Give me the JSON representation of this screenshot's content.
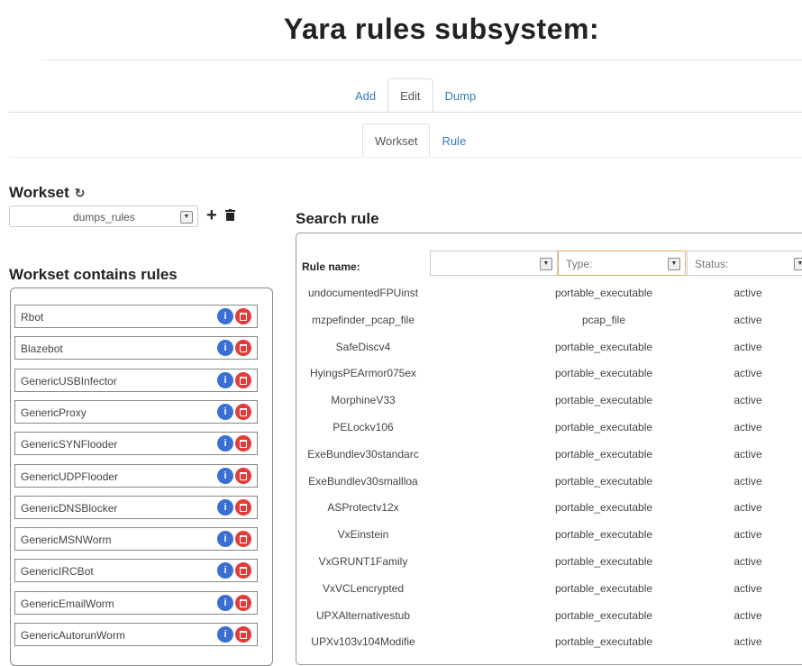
{
  "title": "Yara rules subsystem:",
  "main_tabs": [
    "Add",
    "Edit",
    "Dump"
  ],
  "sub_tabs": [
    "Workset",
    "Rule"
  ],
  "workset": {
    "heading": "Workset",
    "selected": "dumps_rules"
  },
  "contains": {
    "heading": "Workset contains rules",
    "rules": [
      "Rbot",
      "Blazebot",
      "GenericUSBInfector",
      "GenericProxy",
      "GenericSYNFlooder",
      "GenericUDPFlooder",
      "GenericDNSBlocker",
      "GenericMSNWorm",
      "GenericIRCBot",
      "GenericEmailWorm",
      "GenericAutorunWorm"
    ]
  },
  "search": {
    "heading": "Search rule",
    "rule_name_label": "Rule name:",
    "type_placeholder": "Type:",
    "status_placeholder": "Status:",
    "results": [
      {
        "name": "undocumentedFPUinst",
        "type": "portable_executable",
        "status": "active"
      },
      {
        "name": "mzpefinder_pcap_file",
        "type": "pcap_file",
        "status": "active"
      },
      {
        "name": "SafeDiscv4",
        "type": "portable_executable",
        "status": "active"
      },
      {
        "name": "HyingsPEArmor075ex",
        "type": "portable_executable",
        "status": "active"
      },
      {
        "name": "MorphineV33",
        "type": "portable_executable",
        "status": "active"
      },
      {
        "name": "PELockv106",
        "type": "portable_executable",
        "status": "active"
      },
      {
        "name": "ExeBundlev30standarc",
        "type": "portable_executable",
        "status": "active"
      },
      {
        "name": "ExeBundlev30smallloa",
        "type": "portable_executable",
        "status": "active"
      },
      {
        "name": "ASProtectv12x",
        "type": "portable_executable",
        "status": "active"
      },
      {
        "name": "VxEinstein",
        "type": "portable_executable",
        "status": "active"
      },
      {
        "name": "VxGRUNT1Family",
        "type": "portable_executable",
        "status": "active"
      },
      {
        "name": "VxVCLencrypted",
        "type": "portable_executable",
        "status": "active"
      },
      {
        "name": "UPXAlternativestub",
        "type": "portable_executable",
        "status": "active"
      },
      {
        "name": "UPXv103v104Modifie",
        "type": "portable_executable",
        "status": "active"
      }
    ]
  },
  "colors": {
    "link": "#3a7bbf",
    "info": "#3b6ed3",
    "delete": "#e33b3b"
  }
}
